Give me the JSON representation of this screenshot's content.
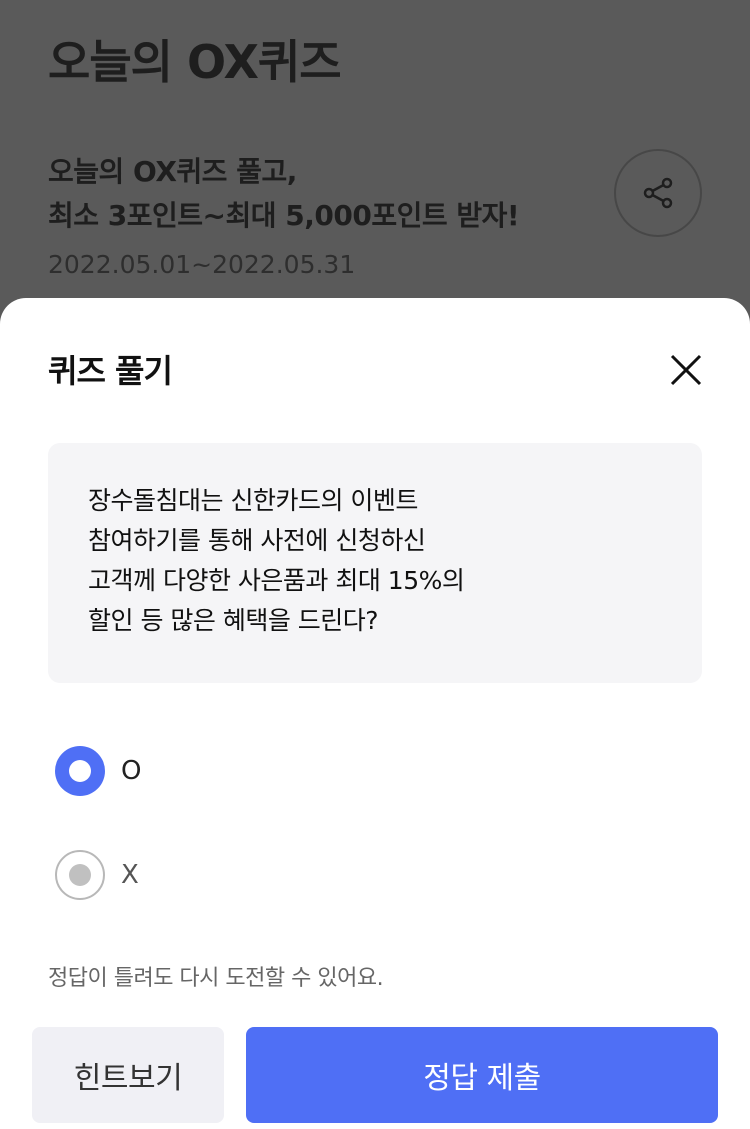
{
  "background": {
    "title": "오늘의 OX퀴즈",
    "subtitle_line1": "오늘의 OX퀴즈 풀고,",
    "subtitle_line2": "최소 3포인트~최대 5,000포인트 받자!",
    "period": "2022.05.01~2022.05.31",
    "share_icon": "share-icon"
  },
  "sheet": {
    "title": "퀴즈 풀기",
    "close_icon": "close-icon",
    "question": "장수돌침대는 신한카드의 이벤트\n참여하기를 통해  사전에 신청하신\n고객께 다양한 사은품과 최대 15%의\n할인 등 많은 혜택을 드린다?",
    "options": [
      {
        "label": "O",
        "selected": true
      },
      {
        "label": "X",
        "selected": false
      }
    ],
    "notice": "정답이 틀려도 다시 도전할 수 있어요.",
    "hint_button": "힌트보기",
    "submit_button": "정답 제출"
  },
  "colors": {
    "accent": "#4f6ff5",
    "overlay": "#5a5a5a",
    "hint_button_bg": "#f0f0f5",
    "question_bg": "#f5f5f7"
  }
}
